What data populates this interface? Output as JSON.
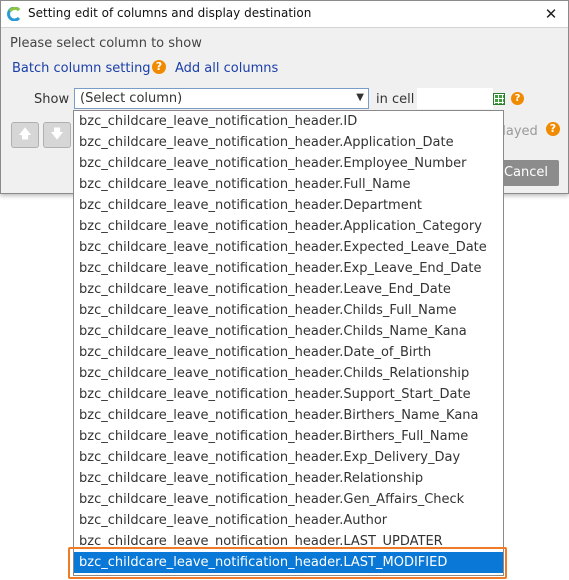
{
  "window": {
    "title": "Setting edit of columns and display destination",
    "close_glyph": "✕"
  },
  "dialog": {
    "instruction": "Please select column to show",
    "batch_link": "Batch column setting",
    "add_all_link": "Add all columns",
    "show_label": "Show",
    "select_value": "(Select column)",
    "in_cell_label": "in cell",
    "cell_value": "",
    "displayed_partial": "played",
    "cancel_label": "Cancel",
    "up_glyph": "🡅",
    "down_glyph": "🡇",
    "help_glyph": "?"
  },
  "dropdown": {
    "selected_index": 21,
    "items": [
      "bzc_childcare_leave_notification_header.ID",
      "bzc_childcare_leave_notification_header.Application_Date",
      "bzc_childcare_leave_notification_header.Employee_Number",
      "bzc_childcare_leave_notification_header.Full_Name",
      "bzc_childcare_leave_notification_header.Department",
      "bzc_childcare_leave_notification_header.Application_Category",
      "bzc_childcare_leave_notification_header.Expected_Leave_Date",
      "bzc_childcare_leave_notification_header.Exp_Leave_End_Date",
      "bzc_childcare_leave_notification_header.Leave_End_Date",
      "bzc_childcare_leave_notification_header.Childs_Full_Name",
      "bzc_childcare_leave_notification_header.Childs_Name_Kana",
      "bzc_childcare_leave_notification_header.Date_of_Birth",
      "bzc_childcare_leave_notification_header.Childs_Relationship",
      "bzc_childcare_leave_notification_header.Support_Start_Date",
      "bzc_childcare_leave_notification_header.Birthers_Name_Kana",
      "bzc_childcare_leave_notification_header.Birthers_Full_Name",
      "bzc_childcare_leave_notification_header.Exp_Delivery_Day",
      "bzc_childcare_leave_notification_header.Relationship",
      "bzc_childcare_leave_notification_header.Gen_Affairs_Check",
      "bzc_childcare_leave_notification_header.Author",
      "bzc_childcare_leave_notification_header.LAST_UPDATER",
      "bzc_childcare_leave_notification_header.LAST_MODIFIED"
    ]
  },
  "colors": {
    "selection": "#0a78d7",
    "highlight": "#f07b26",
    "link": "#1a3fa8",
    "help": "#f08a00"
  }
}
